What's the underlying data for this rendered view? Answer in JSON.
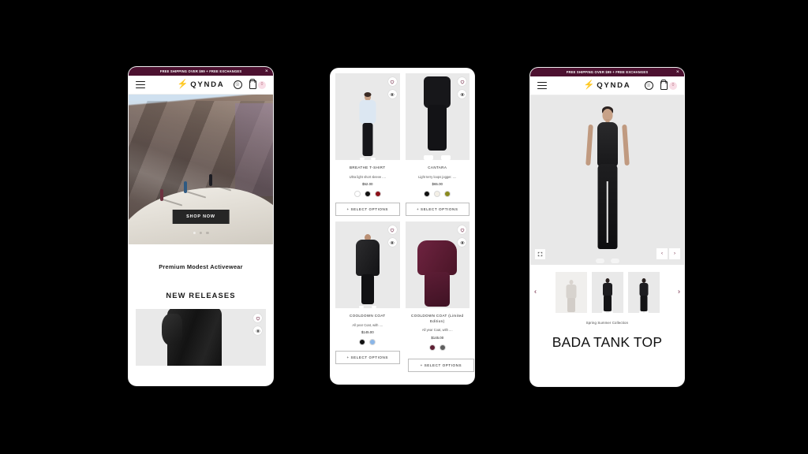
{
  "banner": {
    "text": "FREE SHIPPING OVER $99 + FREE EXCHANGES",
    "close_icon": "close-icon",
    "bg_color": "#4c1130"
  },
  "header": {
    "menu_icon": "hamburger-menu-icon",
    "logo_mark": "⚡",
    "logo_text": "QYNDA",
    "account_icon": "account-icon",
    "cart_icon": "shopping-bag-icon",
    "cart_count": "0",
    "cart_badge_color": "#f8dde6"
  },
  "home": {
    "hero_cta": "SHOP NOW",
    "carousel_dots": 3,
    "active_dot": 1,
    "tagline": "Premium Modest Activewear",
    "section_title": "NEW RELEASES",
    "wishlist_icon": "heart-icon",
    "quickview_icon": "eye-icon"
  },
  "listing": {
    "select_label": "+ SELECT OPTIONS",
    "wishlist_icon": "heart-icon",
    "quickview_icon": "eye-icon",
    "products": [
      {
        "name": "BREATHE T-SHIRT",
        "desc": "Ultra light short sleeve ....",
        "price": "$52.00",
        "colors": [
          "#ffffff",
          "#111111",
          "#8c0f18"
        ]
      },
      {
        "name": "CANTARA",
        "desc": "Light terry loops jogger. ....",
        "price": "$65.00",
        "colors": [
          "#111111",
          "#f3efe6",
          "#8a8a1e"
        ]
      },
      {
        "name": "COOLDOWN COAT",
        "desc": "All year Coat, with ....",
        "price": "$145.00",
        "colors": [
          "#111111",
          "#8ab6e8"
        ]
      },
      {
        "name": "COOLDOWN COAT (Limited Edition)",
        "desc": "All year Coat, with ....",
        "price": "$145.00",
        "colors": [
          "#5e1f33",
          "#5e5e5e"
        ]
      }
    ]
  },
  "pdp": {
    "collection": "Spring Summer Collection",
    "title": "BADA TANK TOP",
    "expand_icon": "expand-icon",
    "prev_label": "‹",
    "next_label": "›",
    "thumb_prev_icon": "chevron-left-icon",
    "thumb_next_icon": "chevron-right-icon",
    "thumbnails": 3
  }
}
